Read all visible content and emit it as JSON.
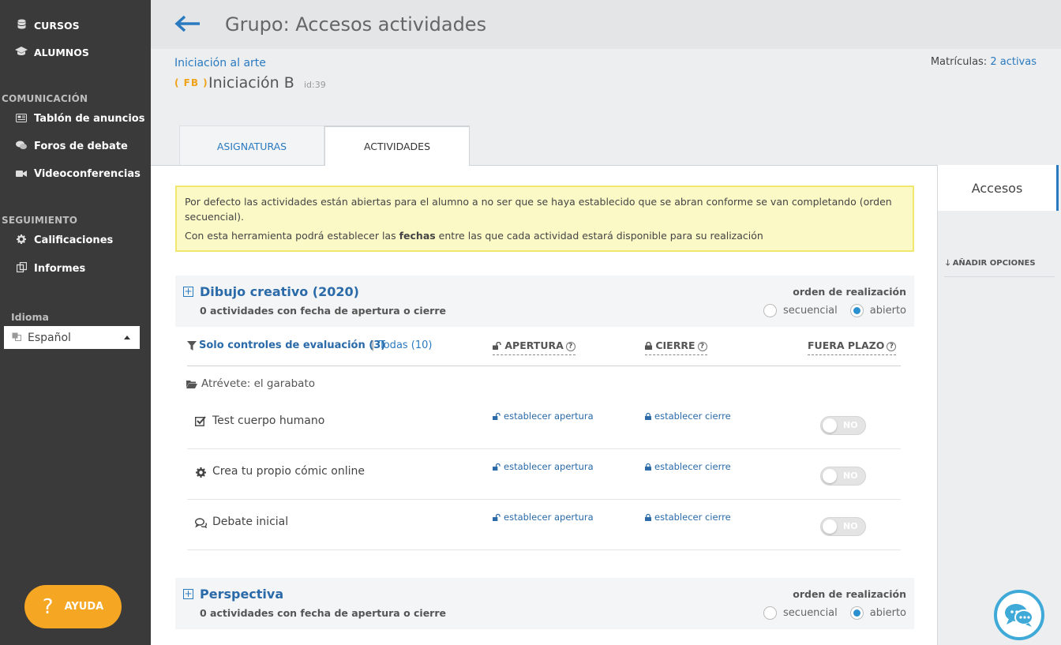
{
  "sidebar": {
    "items_top": [
      {
        "label": "CURSOS",
        "icon": "database-icon"
      },
      {
        "label": "ALUMNOS",
        "icon": "graduation-cap-icon"
      }
    ],
    "sections": [
      {
        "title": "COMUNICACIÓN",
        "items": [
          {
            "label": "Tablón de anuncios",
            "icon": "newspaper-icon"
          },
          {
            "label": "Foros de debate",
            "icon": "comments-icon"
          },
          {
            "label": "Videoconferencias",
            "icon": "video-camera-icon"
          }
        ]
      },
      {
        "title": "SEGUIMIENTO",
        "items": [
          {
            "label": "Calificaciones",
            "icon": "gear-icon"
          },
          {
            "label": "Informes",
            "icon": "copy-icon"
          }
        ]
      }
    ],
    "language_label": "Idioma",
    "language_value": "Español",
    "help_label": "AYUDA"
  },
  "header": {
    "title": "Grupo: Accesos actividades",
    "course_link": "Iniciación al arte",
    "tag": "( FB )",
    "group_name": "Iniciación B",
    "group_id": "id:39",
    "enrollments_label": "Matrículas:",
    "enrollments_value": "2 activas"
  },
  "tabs": [
    {
      "label": "ASIGNATURAS",
      "active": false
    },
    {
      "label": "ACTIVIDADES",
      "active": true
    }
  ],
  "right_panel": {
    "tab_label": "Accesos",
    "add_options": "AÑADIR OPCIONES"
  },
  "notice": {
    "line1": "Por defecto las actividades están abiertas para el alumno a no ser que se haya establecido que se abran conforme se van completando (orden secuencial).",
    "line2_pre": "Con esta herramienta podrá establecer las ",
    "line2_bold": "fechas",
    "line2_post": " entre las que cada actividad estará disponible para su realización"
  },
  "sections": [
    {
      "title": "Dibujo creativo (2020)",
      "subtitle": "0 actividades con fecha de apertura o cierre",
      "order_label": "orden de realización",
      "options": [
        "secuencial",
        "abierto"
      ],
      "selected": "abierto"
    },
    {
      "title": "Perspectiva",
      "subtitle": "0 actividades con fecha de apertura o cierre",
      "order_label": "orden de realización",
      "options": [
        "secuencial",
        "abierto"
      ],
      "selected": "abierto"
    }
  ],
  "filter": {
    "selected": "Solo controles de evaluación (3)",
    "separator": "|",
    "all": "Todas (10)"
  },
  "columns": {
    "open": "APERTURA",
    "close": "CIERRE",
    "late": "FUERA PLAZO",
    "help_glyph": "?"
  },
  "folder": "Atrévete: el garabato",
  "activities": [
    {
      "name": "Test cuerpo humano",
      "icon": "check-square-icon",
      "open_link": "establecer apertura",
      "close_link": "establecer cierre",
      "late": "NO"
    },
    {
      "name": "Crea tu propio cómic online",
      "icon": "gear-icon",
      "open_link": "establecer apertura",
      "close_link": "establecer cierre",
      "late": "NO"
    },
    {
      "name": "Debate inicial",
      "icon": "comments-icon",
      "open_link": "establecer apertura",
      "close_link": "establecer cierre",
      "late": "NO"
    }
  ],
  "colors": {
    "sidebar_bg": "#3a3a3a",
    "accent_blue": "#2a7ac0",
    "help_orange": "#f5a623",
    "notice_bg": "#fbf9c6",
    "chat_ring": "#3fa9d8"
  }
}
